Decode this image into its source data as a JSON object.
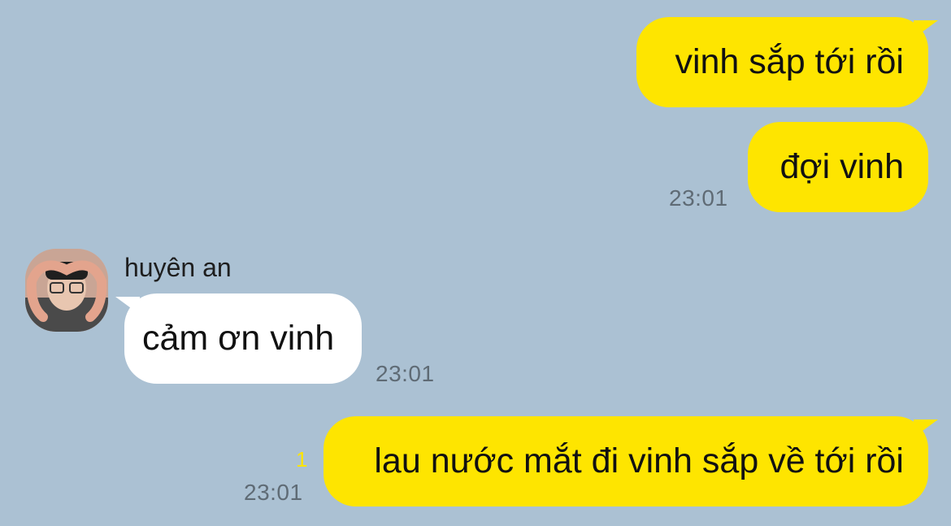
{
  "conversation": {
    "messages": [
      {
        "direction": "outgoing",
        "text": "vinh sắp tới rồi",
        "time": ""
      },
      {
        "direction": "outgoing",
        "text": "đợi vinh",
        "time": "23:01"
      },
      {
        "direction": "incoming",
        "sender": "huyên an",
        "avatar": "profile-photo",
        "text": "cảm ơn vinh",
        "time": "23:01"
      },
      {
        "direction": "outgoing",
        "text": "lau nước mắt đi vinh sắp về tới rồi",
        "time": "23:01",
        "unread_count": "1"
      }
    ]
  },
  "colors": {
    "background": "#abc1d3",
    "outgoing_bubble": "#fee500",
    "incoming_bubble": "#ffffff",
    "timestamp": "#5f6b75",
    "unread": "#fee500"
  }
}
